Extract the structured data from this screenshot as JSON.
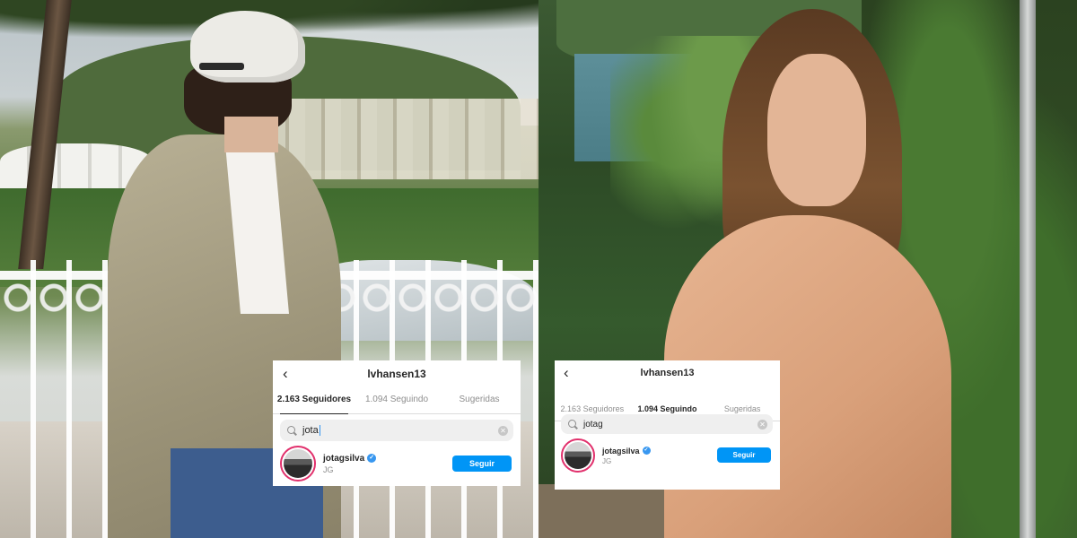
{
  "photos": {
    "left": {
      "subject": "man-in-cap-on-balcony"
    },
    "right": {
      "subject": "long-haired-man-tropical"
    }
  },
  "cards": [
    {
      "back_icon": "chevron-left-icon",
      "username": "lvhansen13",
      "tabs": [
        {
          "label": "2.163 Seguidores",
          "active": true
        },
        {
          "label": "1.094 Seguindo",
          "active": false
        },
        {
          "label": "Sugeridas",
          "active": false
        }
      ],
      "search": {
        "query": "jota",
        "icon": "search-icon",
        "clear_icon": "clear-icon"
      },
      "result": {
        "handle": "jotagsilva",
        "verified_icon": "verified-badge-icon",
        "full_name": "JG",
        "follow_label": "Seguir"
      }
    },
    {
      "back_icon": "chevron-left-icon",
      "username": "lvhansen13",
      "tabs": [
        {
          "label": "2.163 Seguidores",
          "active": false
        },
        {
          "label": "1.094 Seguindo",
          "active": true
        },
        {
          "label": "Sugeridas",
          "active": false
        }
      ],
      "search": {
        "query": "jotag",
        "icon": "search-icon",
        "clear_icon": "clear-icon"
      },
      "result": {
        "handle": "jotagsilva",
        "verified_icon": "verified-badge-icon",
        "full_name": "JG",
        "follow_label": "Seguir"
      }
    }
  ],
  "colors": {
    "follow_button": "#0095f6",
    "story_ring": "#e1306c",
    "verified": "#3897f0"
  }
}
